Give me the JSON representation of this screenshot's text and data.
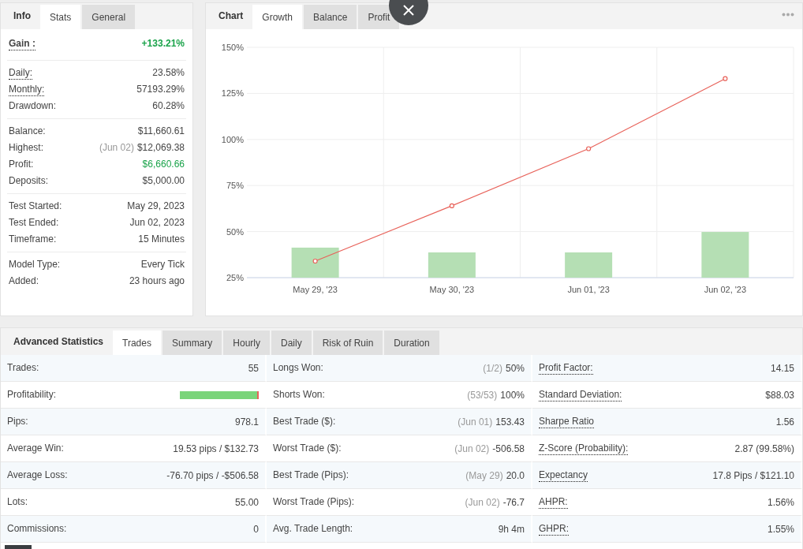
{
  "info_panel": {
    "heading": "Info",
    "tabs": [
      {
        "label": "Stats",
        "selected": true
      },
      {
        "label": "General",
        "selected": false
      }
    ],
    "groups": [
      {
        "kind": "headline",
        "rows": [
          {
            "label": "Gain :",
            "value": "+133.21%",
            "underlined": true,
            "positive": true
          }
        ]
      },
      {
        "kind": "plain",
        "rows": [
          {
            "label": "Daily:",
            "value": "23.58%",
            "underlined": true,
            "positive": false
          },
          {
            "label": "Monthly:",
            "value": "57193.29%",
            "underlined": true,
            "positive": false
          },
          {
            "label": "Drawdown:",
            "value": "60.28%",
            "underlined": false,
            "positive": false
          }
        ]
      },
      {
        "kind": "plain",
        "rows": [
          {
            "label": "Balance:",
            "value": "$11,660.61",
            "underlined": false,
            "positive": false
          },
          {
            "label": "Highest:",
            "note": "(Jun 02)",
            "value": "$12,069.38",
            "underlined": false,
            "positive": false
          },
          {
            "label": "Profit:",
            "value": "$6,660.66",
            "underlined": false,
            "positive": true
          },
          {
            "label": "Deposits:",
            "value": "$5,000.00",
            "underlined": false,
            "positive": false
          }
        ]
      },
      {
        "kind": "plain",
        "rows": [
          {
            "label": "Test Started:",
            "value": "May 29, 2023",
            "underlined": false,
            "positive": false
          },
          {
            "label": "Test Ended:",
            "value": "Jun 02, 2023",
            "underlined": false,
            "positive": false
          },
          {
            "label": "Timeframe:",
            "value": "15 Minutes",
            "underlined": false,
            "positive": false
          }
        ]
      },
      {
        "kind": "plain",
        "rows": [
          {
            "label": "Model Type:",
            "value": "Every Tick",
            "underlined": false,
            "positive": false
          },
          {
            "label": "Added:",
            "value": "23 hours ago",
            "underlined": false,
            "positive": false
          }
        ]
      }
    ]
  },
  "chart_panel": {
    "heading": "Chart",
    "tabs": [
      {
        "label": "Growth",
        "selected": true
      },
      {
        "label": "Balance",
        "selected": false
      },
      {
        "label": "Profit",
        "selected": false
      }
    ],
    "chart_data": {
      "type": "line",
      "grid": true,
      "categories": [
        "May 29, '23",
        "May 30, '23",
        "Jun 01, '23",
        "Jun 02, '23"
      ],
      "ylim": [
        25,
        150
      ],
      "yticks": [
        {
          "value": 25,
          "label": "25%"
        },
        {
          "value": 50,
          "label": "50%"
        },
        {
          "value": 75,
          "label": "75%"
        },
        {
          "value": 100,
          "label": "100%"
        },
        {
          "value": 125,
          "label": "125%"
        },
        {
          "value": 150,
          "label": "150%"
        }
      ],
      "series": [
        {
          "type": "bar",
          "color": "#b5dfb4",
          "values": [
            41.3,
            38.7,
            38.7,
            49.8
          ]
        },
        {
          "type": "line",
          "color": "#e8625a",
          "marker": true,
          "values": [
            34,
            64,
            95,
            133
          ]
        }
      ]
    }
  },
  "advanced_statistics": {
    "heading": "Advanced Statistics",
    "tabs": [
      {
        "label": "Trades",
        "selected": true
      },
      {
        "label": "Summary",
        "selected": false
      },
      {
        "label": "Hourly",
        "selected": false
      },
      {
        "label": "Daily",
        "selected": false
      },
      {
        "label": "Risk of Ruin",
        "selected": false
      },
      {
        "label": "Duration",
        "selected": false
      }
    ],
    "rows": [
      {
        "cells": [
          {
            "kind": "text",
            "label": "Trades:",
            "value": "55",
            "underlined": false
          },
          {
            "kind": "text",
            "label": "Longs Won:",
            "note": "(1/2)",
            "value": "50%",
            "underlined": false
          },
          {
            "kind": "text",
            "label": "Profit Factor:",
            "value": "14.15",
            "underlined": true
          }
        ]
      },
      {
        "cells": [
          {
            "kind": "bar",
            "label": "Profitability:",
            "level": 0.98,
            "underlined": false
          },
          {
            "kind": "text",
            "label": "Shorts Won:",
            "note": "(53/53)",
            "value": "100%",
            "underlined": false
          },
          {
            "kind": "text",
            "label": "Standard Deviation:",
            "value": "$88.03",
            "underlined": true
          }
        ]
      },
      {
        "cells": [
          {
            "kind": "text",
            "label": "Pips:",
            "value": "978.1",
            "underlined": false
          },
          {
            "kind": "text",
            "label": "Best Trade ($):",
            "note": "(Jun 01)",
            "value": "153.43",
            "underlined": false
          },
          {
            "kind": "text",
            "label": "Sharpe Ratio",
            "value": "1.56",
            "underlined": true
          }
        ]
      },
      {
        "cells": [
          {
            "kind": "text",
            "label": "Average Win:",
            "value": "19.53 pips / $132.73",
            "underlined": false
          },
          {
            "kind": "text",
            "label": "Worst Trade ($):",
            "note": "(Jun 02)",
            "value": "-506.58",
            "underlined": false
          },
          {
            "kind": "text",
            "label": "Z-Score (Probability):",
            "value": "2.87 (99.58%)",
            "underlined": true
          }
        ]
      },
      {
        "cells": [
          {
            "kind": "text",
            "label": "Average Loss:",
            "value": "-76.70 pips / -$506.58",
            "underlined": false
          },
          {
            "kind": "text",
            "label": "Best Trade (Pips):",
            "note": "(May 29)",
            "value": "20.0",
            "underlined": false
          },
          {
            "kind": "text",
            "label": "Expectancy",
            "value": "17.8 Pips / $121.10",
            "underlined": true
          }
        ]
      },
      {
        "cells": [
          {
            "kind": "text",
            "label": "Lots:",
            "value": "55.00",
            "underlined": false
          },
          {
            "kind": "text",
            "label": "Worst Trade (Pips):",
            "note": "(Jun 02)",
            "value": "-76.7",
            "underlined": false
          },
          {
            "kind": "text",
            "label": "AHPR:",
            "value": "1.56%",
            "underlined": true
          }
        ]
      },
      {
        "cells": [
          {
            "kind": "text",
            "label": "Commissions:",
            "value": "0",
            "underlined": false
          },
          {
            "kind": "text",
            "label": "Avg. Trade Length:",
            "value": "9h 4m",
            "underlined": false
          },
          {
            "kind": "text",
            "label": "GHPR:",
            "value": "1.55%",
            "underlined": true
          }
        ]
      }
    ]
  }
}
